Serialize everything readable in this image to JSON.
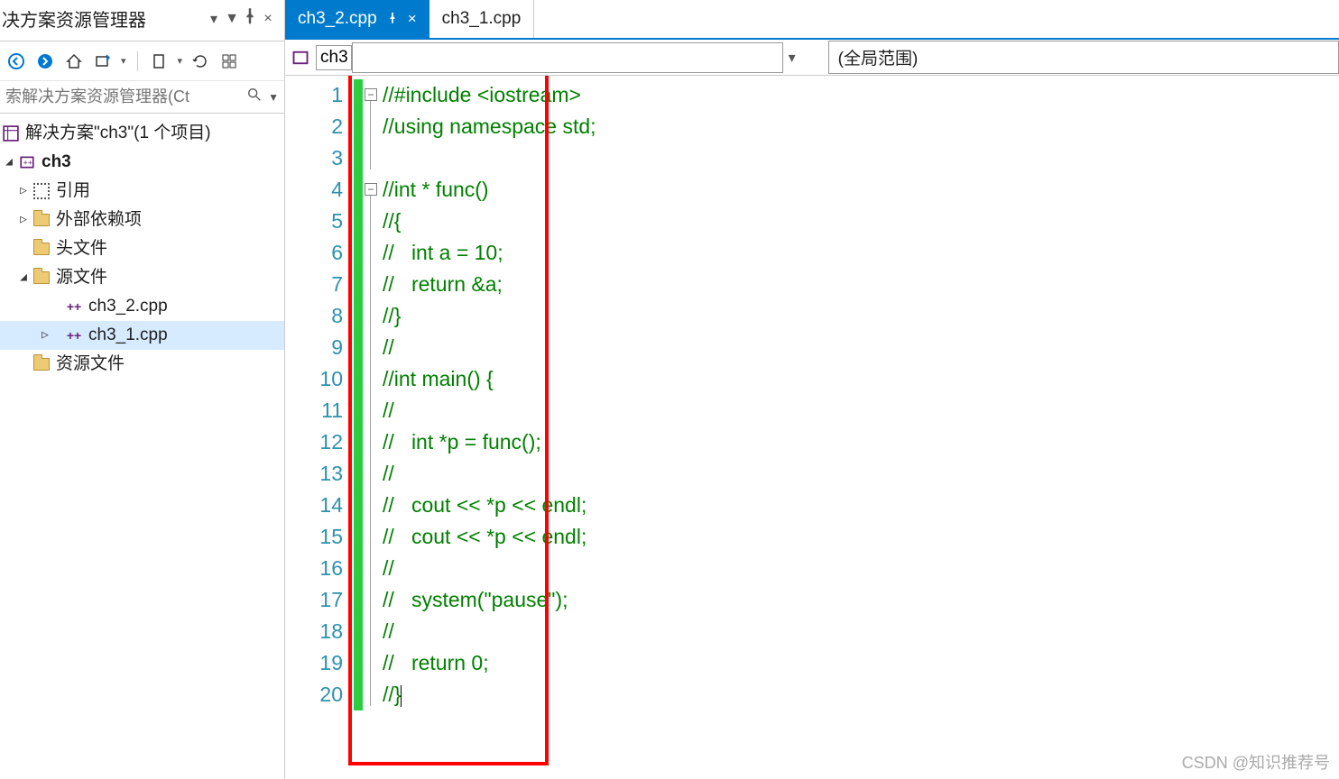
{
  "panel": {
    "title": "决方案资源管理器",
    "dropdown_caret": "▾",
    "pin": "📌",
    "close": "×",
    "search_placeholder": "索解决方案资源管理器(Ct",
    "solution_label": "解决方案\"ch3\"(1 个项目)",
    "project": "ch3",
    "references": "引用",
    "external": "外部依赖项",
    "headers": "头文件",
    "sources": "源文件",
    "file1": "ch3_2.cpp",
    "file2": "ch3_1.cpp",
    "resources": "资源文件"
  },
  "tabs": {
    "active": "ch3_2.cpp",
    "inactive": "ch3_1.cpp"
  },
  "nav": {
    "scope": "ch3",
    "global": "(全局范围)"
  },
  "code": {
    "lines": [
      "//#include <iostream>",
      "//using namespace std;",
      "",
      "//int * func()",
      "//{",
      "//   int a = 10;",
      "//   return &a;",
      "//}",
      "//",
      "//int main() {",
      "//",
      "//   int *p = func();",
      "//",
      "//   cout << *p << endl;",
      "//   cout << *p << endl;",
      "//",
      "//   system(\"pause\");",
      "//",
      "//   return 0;",
      "//}"
    ]
  },
  "watermark": "CSDN @知识推荐号"
}
